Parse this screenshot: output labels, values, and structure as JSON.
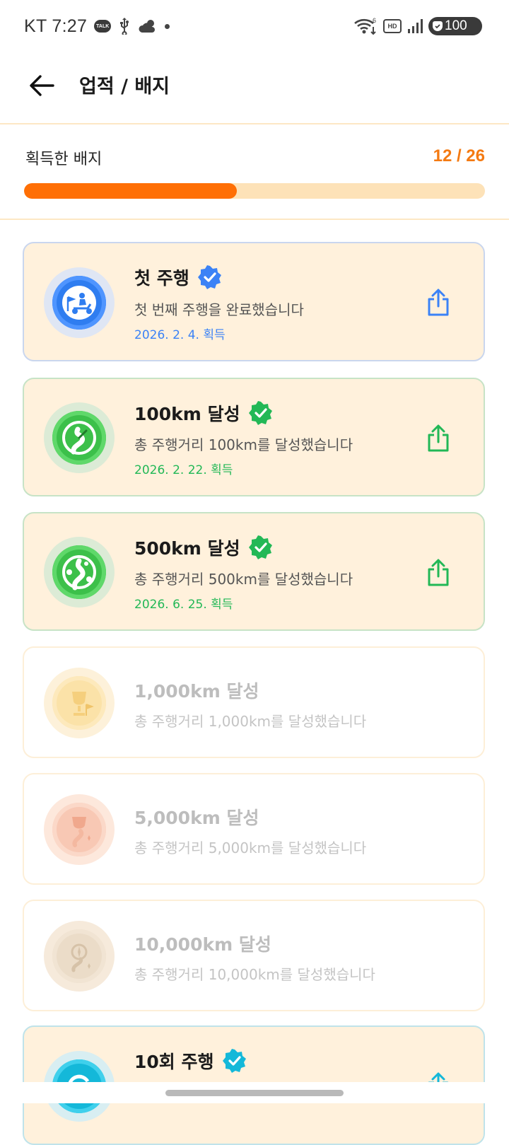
{
  "status_bar": {
    "carrier": "KT",
    "time": "7:27",
    "talk_label": "TALK",
    "hd_label": "HD",
    "wifi_sub": "6",
    "battery": "100"
  },
  "app_bar": {
    "title": "업적 / 배지",
    "back_icon": "arrow-left-icon"
  },
  "progress": {
    "label": "획득한 배지",
    "count_text": "12 / 26",
    "earned": 12,
    "total": 26,
    "fill_color": "#ff6f05",
    "track_color": "#fde2b8"
  },
  "badges": [
    {
      "title": "첫 주행",
      "description": "첫 번째 주행을 완료했습니다",
      "date": "2026. 2. 4. 획득",
      "earned": true,
      "accent": "#3b82f6",
      "icon": "scooter-rider-icon"
    },
    {
      "title": "100km 달성",
      "description": "총 주행거리 100km를 달성했습니다",
      "date": "2026. 2. 22. 획득",
      "earned": true,
      "accent": "#22c55e",
      "icon": "speedometer-road-icon"
    },
    {
      "title": "500km 달성",
      "description": "총 주행거리 500km를 달성했습니다",
      "date": "2026. 6. 25. 획득",
      "earned": true,
      "accent": "#22c55e",
      "icon": "road-pins-icon"
    },
    {
      "title": "1,000km 달성",
      "description": "총 주행거리 1,000km를 달성했습니다",
      "earned": false,
      "accent": "#f6c453",
      "icon": "trophy-flag-icon"
    },
    {
      "title": "5,000km 달성",
      "description": "총 주행거리 5,000km를 달성했습니다",
      "earned": false,
      "accent": "#f4a184",
      "icon": "trophy-road-icon"
    },
    {
      "title": "10,000km 달성",
      "description": "총 주행거리 10,000km를 달성했습니다",
      "earned": false,
      "accent": "#c9b59a",
      "icon": "compass-medal-icon"
    },
    {
      "title": "10회 주행",
      "earned": true,
      "accent": "#14b8d9",
      "icon": "repeat-ride-icon"
    }
  ]
}
